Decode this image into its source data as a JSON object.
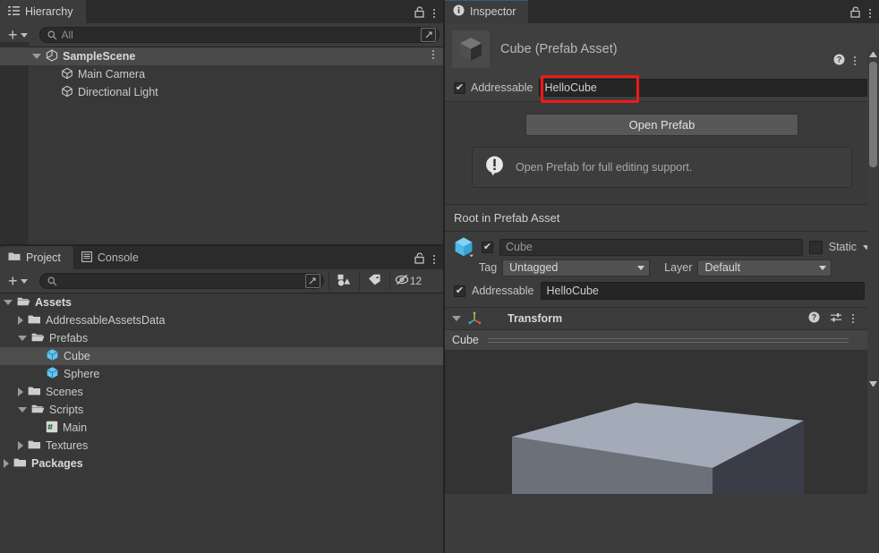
{
  "hierarchy": {
    "tab": {
      "label": "Hierarchy",
      "icon": "hierarchy-icon"
    },
    "toolbar": {
      "add_label": "+",
      "search_value": "All",
      "search_placeholder": "All"
    },
    "items": [
      {
        "label": "SampleScene",
        "icon": "scene-icon",
        "depth": 1,
        "expanded": true,
        "selected": true,
        "bold": true,
        "has_menu": true
      },
      {
        "label": "Main Camera",
        "icon": "gameobject-icon",
        "depth": 2,
        "expanded": null,
        "selected": false,
        "bold": false,
        "has_menu": false
      },
      {
        "label": "Directional Light",
        "icon": "gameobject-icon",
        "depth": 2,
        "expanded": null,
        "selected": false,
        "bold": false,
        "has_menu": false
      }
    ]
  },
  "project": {
    "tabs": [
      {
        "label": "Project",
        "icon": "folder-icon",
        "active": true
      },
      {
        "label": "Console",
        "icon": "console-icon",
        "active": false
      }
    ],
    "toolbar": {
      "add_label": "+",
      "search_value": "",
      "search_placeholder": "",
      "filters": [
        {
          "name": "type-filter-icon",
          "label": ""
        },
        {
          "name": "label-filter-icon",
          "label": ""
        },
        {
          "name": "hidden-count-icon",
          "label": "12"
        }
      ]
    },
    "tree": [
      {
        "label": "Assets",
        "icon": "folder-open-icon",
        "depth": 0,
        "expanded": true,
        "selected": false,
        "bold": true
      },
      {
        "label": "AddressableAssetsData",
        "icon": "folder-icon",
        "depth": 1,
        "expanded": false,
        "selected": false,
        "bold": false
      },
      {
        "label": "Prefabs",
        "icon": "folder-open-icon",
        "depth": 1,
        "expanded": true,
        "selected": false,
        "bold": false
      },
      {
        "label": "Cube",
        "icon": "prefab-icon",
        "depth": 2,
        "expanded": null,
        "selected": true,
        "bold": false
      },
      {
        "label": "Sphere",
        "icon": "prefab-icon",
        "depth": 2,
        "expanded": null,
        "selected": false,
        "bold": false
      },
      {
        "label": "Scenes",
        "icon": "folder-icon",
        "depth": 1,
        "expanded": false,
        "selected": false,
        "bold": false
      },
      {
        "label": "Scripts",
        "icon": "folder-open-icon",
        "depth": 1,
        "expanded": true,
        "selected": false,
        "bold": false
      },
      {
        "label": "Main",
        "icon": "csharp-script-icon",
        "depth": 2,
        "expanded": null,
        "selected": false,
        "bold": false
      },
      {
        "label": "Textures",
        "icon": "folder-icon",
        "depth": 1,
        "expanded": false,
        "selected": false,
        "bold": false
      },
      {
        "label": "Packages",
        "icon": "folder-icon",
        "depth": 0,
        "expanded": false,
        "selected": false,
        "bold": true
      }
    ]
  },
  "inspector": {
    "tab": {
      "label": "Inspector",
      "icon": "info-icon"
    },
    "asset": {
      "title": "Cube (Prefab Asset)",
      "thumbnail": "cube-thumbnail"
    },
    "addressable_top": {
      "checkbox_label": "Addressable",
      "checked": true,
      "address_value": "HelloCube",
      "highlight_color": "#f01818"
    },
    "prefab": {
      "open_button": "Open Prefab",
      "help_message": "Open Prefab for full editing support.",
      "help_icon": "warning-icon"
    },
    "root_section_label": "Root in Prefab Asset",
    "gameobject": {
      "enabled": true,
      "name": "Cube",
      "static_label": "Static",
      "static_checked": false,
      "tag_label": "Tag",
      "tag_value": "Untagged",
      "layer_label": "Layer",
      "layer_value": "Default",
      "addressable_label": "Addressable",
      "addressable_checked": true,
      "addressable_value": "HelloCube"
    },
    "components": [
      {
        "name": "Transform",
        "expanded": true,
        "icon": "transform-icon"
      }
    ],
    "preview": {
      "name": "Cube",
      "colors": {
        "top": "#a3aab8",
        "left": "#6b7079",
        "right": "#3a3d47",
        "background": "#333333"
      }
    }
  },
  "theme": {
    "window_bg": "#383838",
    "panel_bg": "#3c3c3c",
    "tabbar_bg": "#2b2b2b",
    "accent": "#2c5d87",
    "text": "#c4c4c4",
    "selection": "#4a4a4a",
    "prefab_blue": "#66c9f2"
  }
}
